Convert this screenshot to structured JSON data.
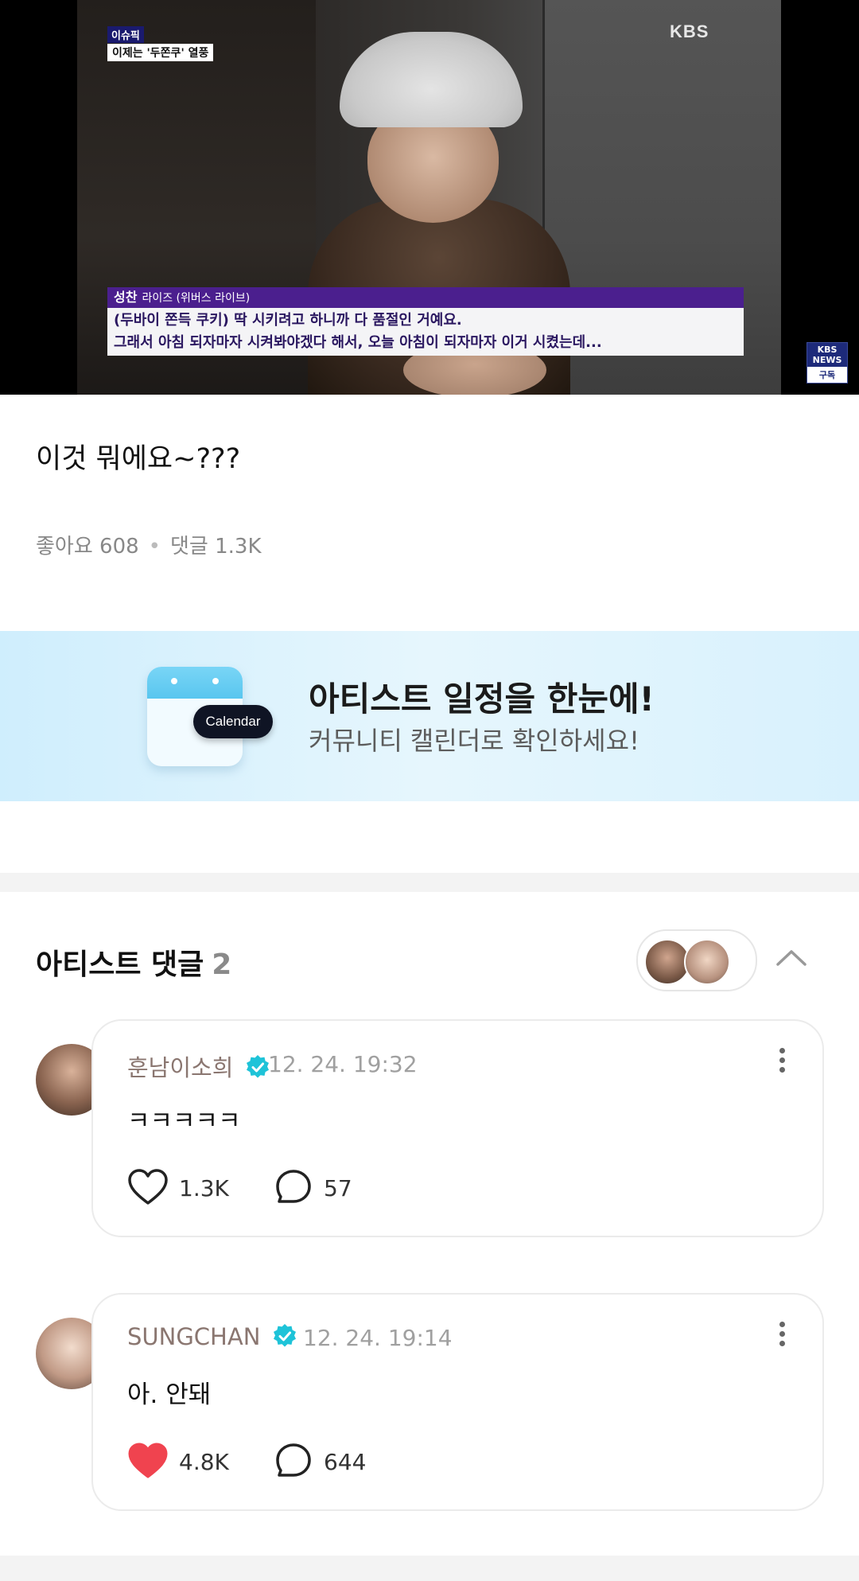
{
  "video": {
    "issue_tag": "이슈픽",
    "issue_headline": "이제는 '두쫀쿠' 열풍",
    "channel_logo": "KBS",
    "speaker_name": "성찬",
    "speaker_meta": "라이즈 (위버스 라이브)",
    "subtitle_line1": "(두바이 쫀득 쿠키) 딱 시키려고 하니까 다 품절인 거예요.",
    "subtitle_line2": "그래서 아침 되자마자 시켜봐야겠다 해서, 오늘 아침이 되자마자 이거 시켰는데...",
    "news_badge_top": "KBS NEWS",
    "news_badge_bottom": "구독"
  },
  "post": {
    "text": "이것 뭐에요~???",
    "likes_label": "좋아요 608",
    "comments_label": "댓글 1.3K"
  },
  "banner": {
    "pill": "Calendar",
    "title": "아티스트 일정을 한눈에!",
    "subtitle": "커뮤니티 캘린더로 확인하세요!",
    "colors": {
      "background": "#d8f1fd",
      "pill": "#0f1424",
      "calendar_header": "#59c6ef"
    }
  },
  "artist_comments": {
    "title": "아티스트 댓글",
    "count": "2",
    "items": [
      {
        "name": "훈남이소희",
        "time": "12. 24. 19:32",
        "body": "ㅋㅋㅋㅋㅋ",
        "likes": "1.3K",
        "liked": false,
        "replies": "57"
      },
      {
        "name": "SUNGCHAN",
        "time": "12. 24. 19:14",
        "body": "아. 안돼",
        "likes": "4.8K",
        "liked": true,
        "replies": "644"
      }
    ]
  },
  "colors": {
    "verified": "#1ec3d8",
    "like_active": "#f0434f",
    "name_text": "#8a7670"
  },
  "icons": [
    "verified-badge-icon",
    "more-vertical-icon",
    "heart-icon",
    "comment-bubble-icon",
    "chevron-up-icon"
  ]
}
